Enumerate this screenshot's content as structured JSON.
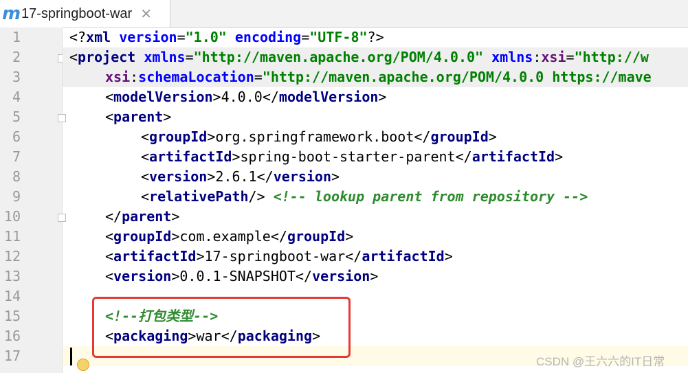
{
  "tab": {
    "icon_letter": "m",
    "title": "17-springboot-war",
    "close": "✕"
  },
  "line_numbers": [
    "1",
    "2",
    "3",
    "4",
    "5",
    "6",
    "7",
    "8",
    "9",
    "10",
    "11",
    "12",
    "13",
    "14",
    "15",
    "16",
    "17"
  ],
  "code": {
    "l1": {
      "a": "<?",
      "b": "xml ",
      "c": "version",
      "d": "=",
      "e": "\"1.0\"",
      "f": " ",
      "g": "encoding",
      "h": "=",
      "i": "\"UTF-8\"",
      "j": "?>"
    },
    "l2": {
      "a": "<",
      "b": "project ",
      "c": "xmlns",
      "d": "=",
      "e": "\"http://maven.apache.org/POM/4.0.0\"",
      "f": " ",
      "g": "xmlns",
      "h": ":",
      "i": "xsi",
      "j": "=",
      "k": "\"http://w"
    },
    "l3": {
      "a": "xsi",
      "b": ":",
      "c": "schemaLocation",
      "d": "=",
      "e": "\"http://maven.apache.org/POM/4.0.0 https://mave"
    },
    "l4": {
      "a": "<",
      "b": "modelVersion",
      "c": ">",
      "d": "4.0.0",
      "e": "</",
      "f": "modelVersion",
      "g": ">"
    },
    "l5": {
      "a": "<",
      "b": "parent",
      "c": ">"
    },
    "l6": {
      "a": "<",
      "b": "groupId",
      "c": ">",
      "d": "org.springframework.boot",
      "e": "</",
      "f": "groupId",
      "g": ">"
    },
    "l7": {
      "a": "<",
      "b": "artifactId",
      "c": ">",
      "d": "spring-boot-starter-parent",
      "e": "</",
      "f": "artifactId",
      "g": ">"
    },
    "l8": {
      "a": "<",
      "b": "version",
      "c": ">",
      "d": "2.6.1",
      "e": "</",
      "f": "version",
      "g": ">"
    },
    "l9": {
      "a": "<",
      "b": "relativePath",
      "c": "/>",
      "d": " ",
      "e": "<!-- lookup parent from repository -->"
    },
    "l10": {
      "a": "</",
      "b": "parent",
      "c": ">"
    },
    "l11": {
      "a": "<",
      "b": "groupId",
      "c": ">",
      "d": "com.example",
      "e": "</",
      "f": "groupId",
      "g": ">"
    },
    "l12": {
      "a": "<",
      "b": "artifactId",
      "c": ">",
      "d": "17-springboot-war",
      "e": "</",
      "f": "artifactId",
      "g": ">"
    },
    "l13": {
      "a": "<",
      "b": "version",
      "c": ">",
      "d": "0.0.1-SNAPSHOT",
      "e": "</",
      "f": "version",
      "g": ">"
    },
    "l15": {
      "a": "<!--打包类型-->"
    },
    "l16": {
      "a": "<",
      "b": "packaging",
      "c": ">",
      "d": "war",
      "e": "</",
      "f": "packaging",
      "g": ">"
    }
  },
  "watermark": "CSDN @王六六的IT日常",
  "colors": {
    "highlight_box": "#e53935",
    "tag": "#000080",
    "attr": "#0000ff",
    "value": "#008000",
    "comment": "#2e8b2e"
  }
}
